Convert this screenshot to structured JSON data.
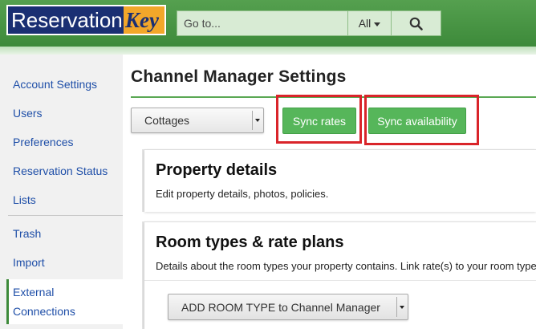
{
  "brand": {
    "logo_left": "Reservation",
    "logo_right": "Key",
    "colors": {
      "navy": "#1a2f73",
      "orange": "#f2a72a",
      "header_green": "#3d8a3a"
    }
  },
  "search": {
    "placeholder": "Go to...",
    "scope": "All",
    "button_icon": "search-icon"
  },
  "sidebar": {
    "items": [
      {
        "label": "Account Settings"
      },
      {
        "label": "Users"
      },
      {
        "label": "Preferences"
      },
      {
        "label": "Reservation Status"
      },
      {
        "label": "Lists"
      },
      {
        "label": "Trash"
      },
      {
        "label": "Import"
      }
    ],
    "active": {
      "line1": "External",
      "line2": "Connections"
    },
    "link_color": "#1f4fa8"
  },
  "main": {
    "title": "Channel Manager Settings",
    "property_select": {
      "value": "Cottages"
    },
    "sync_rates_label": "Sync rates",
    "sync_availability_label": "Sync availability",
    "button_color": "#56b65a",
    "highlight_color": "#d9242a",
    "sections": [
      {
        "title": "Property details",
        "description": "Edit property details, photos, policies."
      },
      {
        "title": "Room types & rate plans",
        "description": "Details about the room types your property contains. Link rate(s) to your room types."
      }
    ],
    "add_room_type_select": {
      "value": "ADD ROOM TYPE to Channel Manager"
    }
  }
}
